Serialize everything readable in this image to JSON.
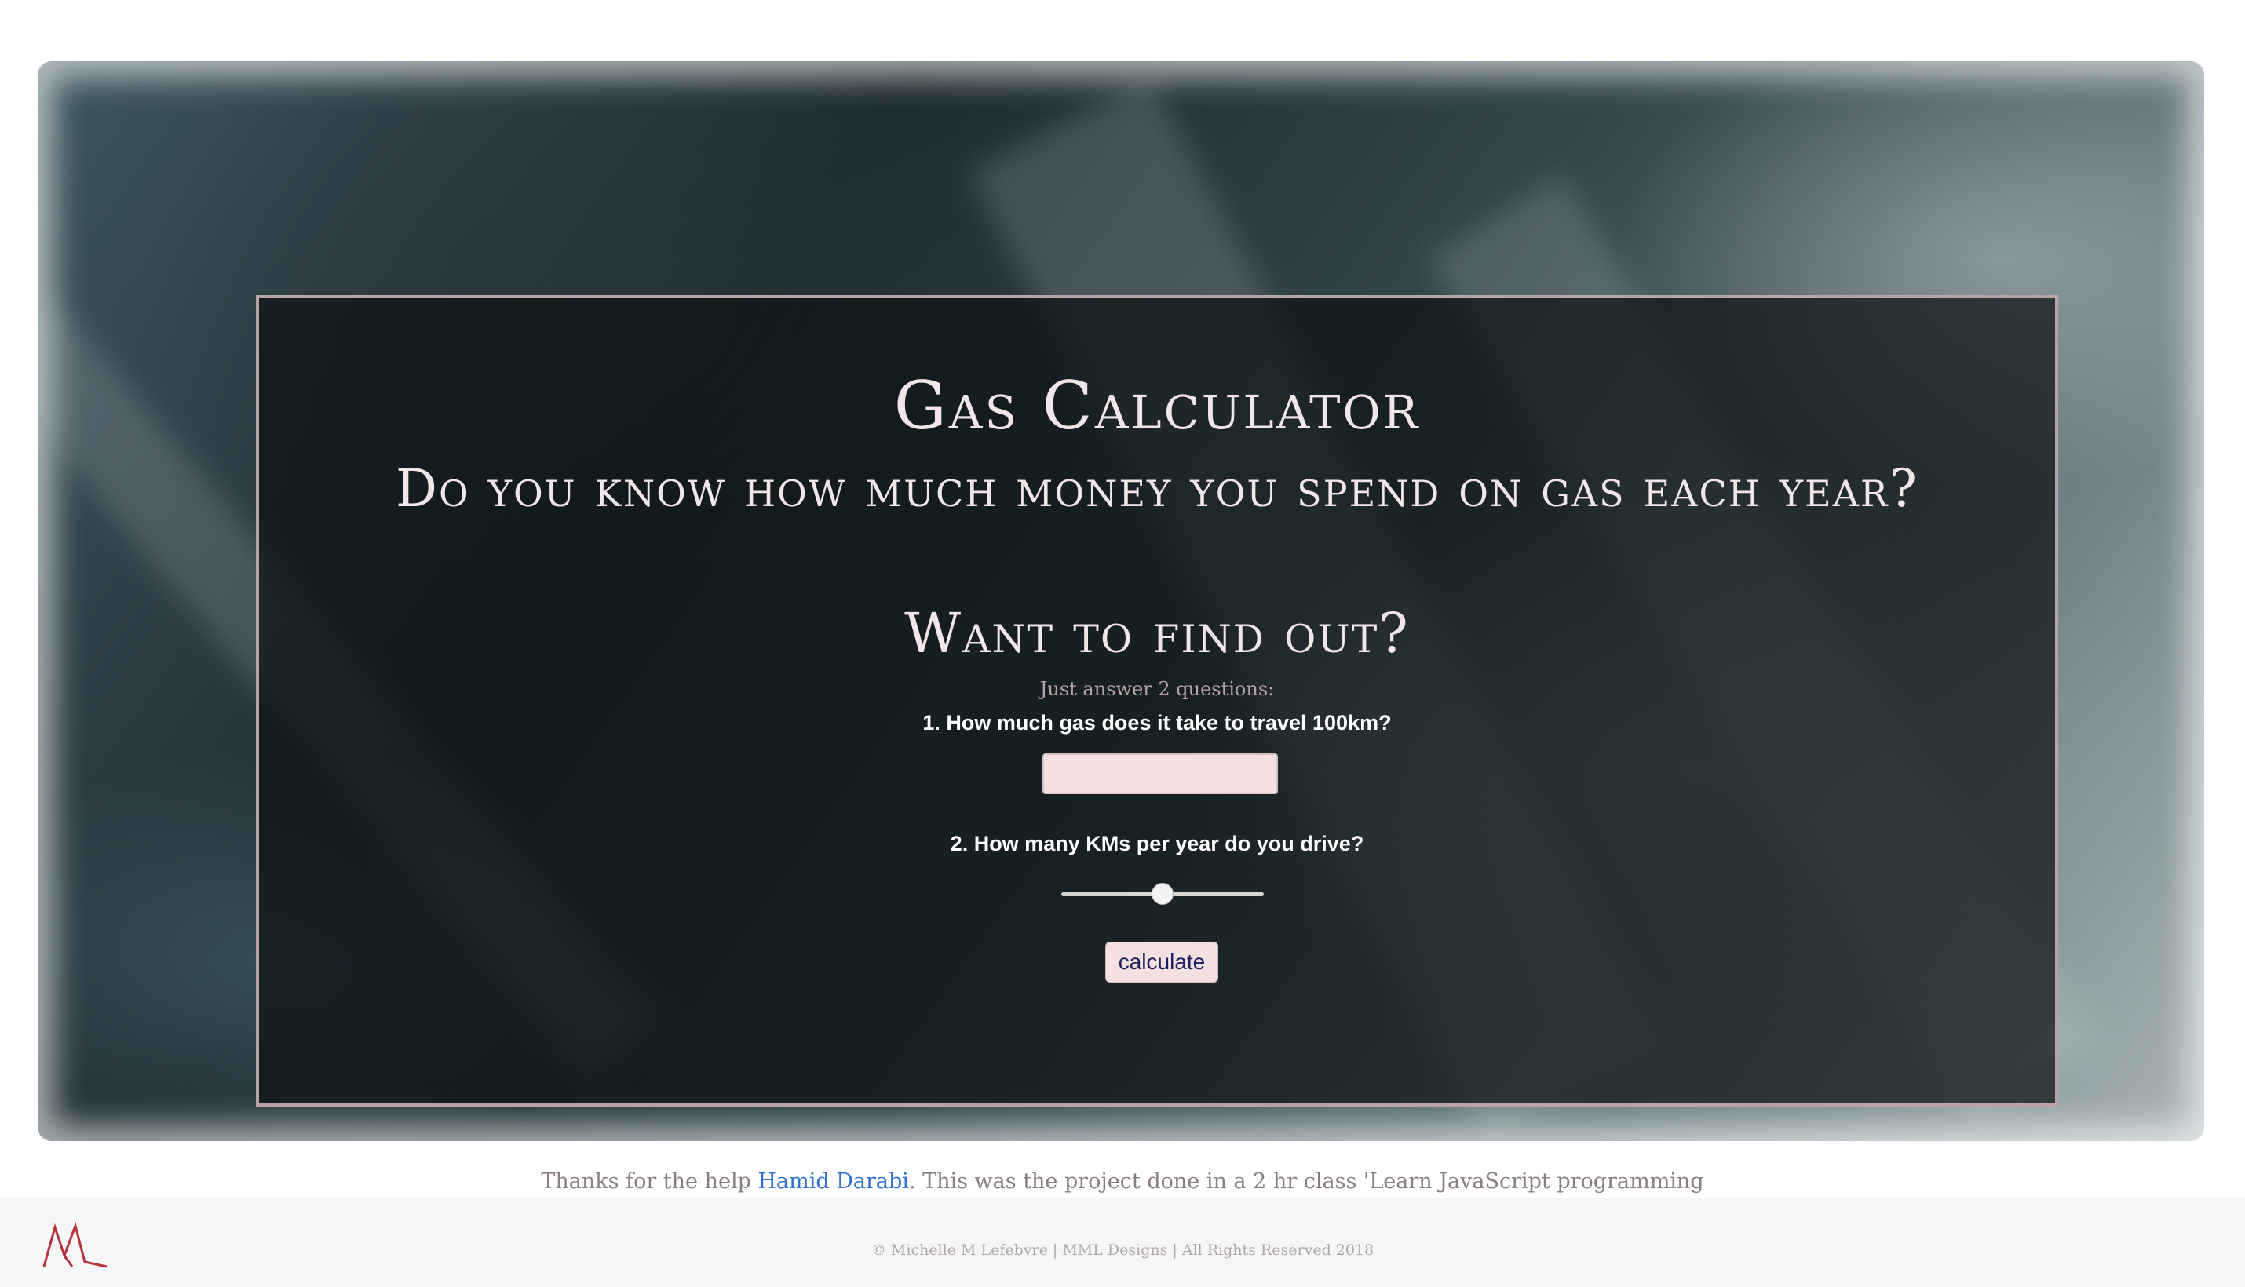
{
  "header": {
    "title": "Gas Calculator",
    "question": "Do you know how much money you spend on gas each year?",
    "prompt": "Want to find out?"
  },
  "form": {
    "hint": "Just answer 2 questions:",
    "q1_label": "1. How much gas does it take to travel 100km?",
    "q1_value": "",
    "q2_label": "2. How many KMs per year do you drive?",
    "q2_slider_level": 0.5,
    "calculate_label": "calculate"
  },
  "credits": {
    "prefix": "Thanks for the help ",
    "link_text": "Hamid Darabi",
    "suffix": ". This was the project done in a 2 hr class 'Learn JavaScript programming"
  },
  "footer": {
    "copyright": "©  Michelle M Lefebvre | MML Designs | All Rights Reserved 2018"
  },
  "colors": {
    "accent": "#b9a3a6",
    "input_bg": "#f4dfe1",
    "link": "#2f6fd0"
  },
  "icons": {
    "logo": "mml-logo-icon"
  }
}
